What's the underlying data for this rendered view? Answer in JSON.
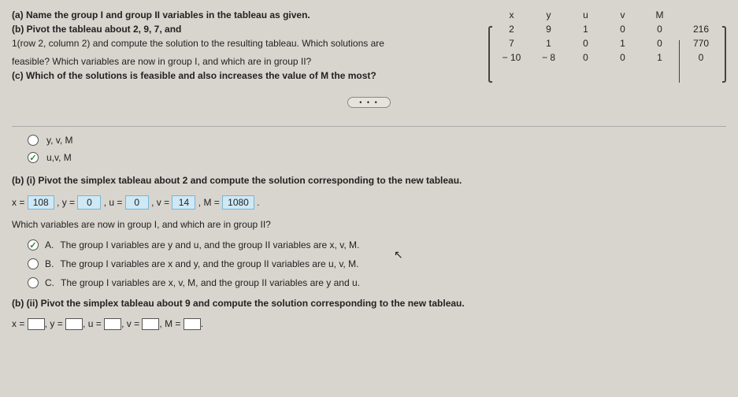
{
  "question": {
    "a": "(a) Name the group I and group II variables in the tableau as given.",
    "b": "(b) Pivot the tableau about 2, 9, 7, and",
    "b2": "1(row 2, column 2) and compute the solution to the resulting tableau. Which solutions are",
    "cont": "feasible? Which variables are now in group I, and which are in group II?",
    "c": "(c) Which of the solutions is feasible and also increases the value of M the most?"
  },
  "tableau": {
    "headers": [
      "x",
      "y",
      "u",
      "v",
      "M"
    ],
    "rows": [
      [
        "2",
        "9",
        "1",
        "0",
        "0"
      ],
      [
        "7",
        "1",
        "0",
        "1",
        "0"
      ],
      [
        "− 10",
        "− 8",
        "0",
        "0",
        "1"
      ]
    ],
    "result": [
      "216",
      "770",
      "0"
    ]
  },
  "more": "• • •",
  "radios1": {
    "opt1": "y, v, M",
    "opt2": "u,v, M"
  },
  "part_bi": {
    "intro": "(b) (i) Pivot the simplex tableau about 2 and compute the solution corresponding to the new tableau.",
    "prefix_x": "x = ",
    "x": "108",
    "sep1": " , y = ",
    "y": "0",
    "sep2": " , u = ",
    "u": "0",
    "sep3": " , v = ",
    "v": "14",
    "sep4": " , M = ",
    "M": "1080",
    "suffix": " .",
    "q2": "Which variables are now in group I, and which are in group II?"
  },
  "radios2": {
    "a_label": "A.",
    "a": "The group I variables are y and u, and the group II variables are x, v, M.",
    "b_label": "B.",
    "b": "The group I variables are x and y, and the group II variables are u, v, M.",
    "c_label": "C.",
    "c": "The group I variables are x, v, M, and the group II variables are y and u."
  },
  "part_bii": {
    "intro": "(b) (ii) Pivot the simplex tableau about 9 and compute the solution corresponding to the new tableau.",
    "eq_x": "x = ",
    "eq_y": ", y = ",
    "eq_u": ", u = ",
    "eq_v": ", v = ",
    "eq_M": ", M = ",
    "period": "."
  }
}
